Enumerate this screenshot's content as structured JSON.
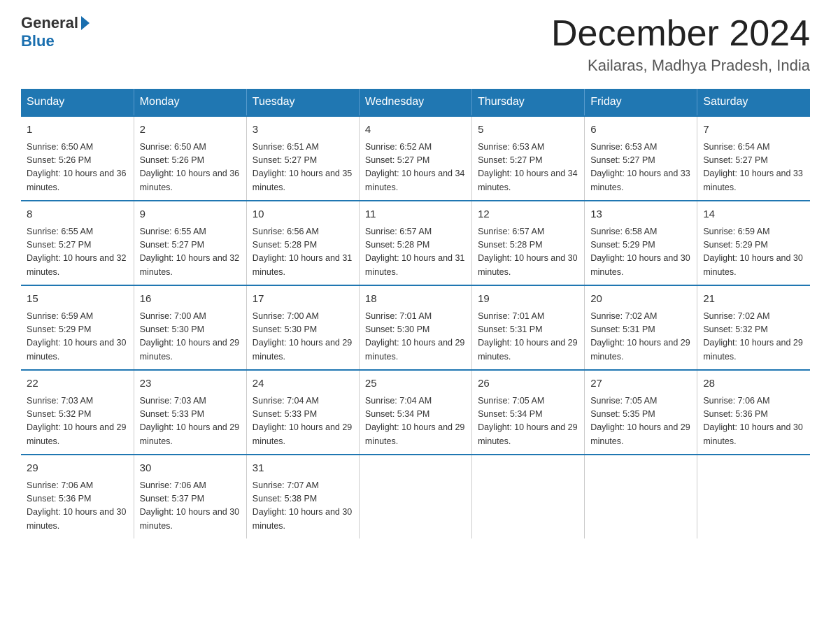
{
  "logo": {
    "text1": "General",
    "text2": "Blue"
  },
  "title": {
    "month_year": "December 2024",
    "location": "Kailaras, Madhya Pradesh, India"
  },
  "days_of_week": [
    "Sunday",
    "Monday",
    "Tuesday",
    "Wednesday",
    "Thursday",
    "Friday",
    "Saturday"
  ],
  "weeks": [
    [
      {
        "day": "1",
        "sunrise": "6:50 AM",
        "sunset": "5:26 PM",
        "daylight": "10 hours and 36 minutes."
      },
      {
        "day": "2",
        "sunrise": "6:50 AM",
        "sunset": "5:26 PM",
        "daylight": "10 hours and 36 minutes."
      },
      {
        "day": "3",
        "sunrise": "6:51 AM",
        "sunset": "5:27 PM",
        "daylight": "10 hours and 35 minutes."
      },
      {
        "day": "4",
        "sunrise": "6:52 AM",
        "sunset": "5:27 PM",
        "daylight": "10 hours and 34 minutes."
      },
      {
        "day": "5",
        "sunrise": "6:53 AM",
        "sunset": "5:27 PM",
        "daylight": "10 hours and 34 minutes."
      },
      {
        "day": "6",
        "sunrise": "6:53 AM",
        "sunset": "5:27 PM",
        "daylight": "10 hours and 33 minutes."
      },
      {
        "day": "7",
        "sunrise": "6:54 AM",
        "sunset": "5:27 PM",
        "daylight": "10 hours and 33 minutes."
      }
    ],
    [
      {
        "day": "8",
        "sunrise": "6:55 AM",
        "sunset": "5:27 PM",
        "daylight": "10 hours and 32 minutes."
      },
      {
        "day": "9",
        "sunrise": "6:55 AM",
        "sunset": "5:27 PM",
        "daylight": "10 hours and 32 minutes."
      },
      {
        "day": "10",
        "sunrise": "6:56 AM",
        "sunset": "5:28 PM",
        "daylight": "10 hours and 31 minutes."
      },
      {
        "day": "11",
        "sunrise": "6:57 AM",
        "sunset": "5:28 PM",
        "daylight": "10 hours and 31 minutes."
      },
      {
        "day": "12",
        "sunrise": "6:57 AM",
        "sunset": "5:28 PM",
        "daylight": "10 hours and 30 minutes."
      },
      {
        "day": "13",
        "sunrise": "6:58 AM",
        "sunset": "5:29 PM",
        "daylight": "10 hours and 30 minutes."
      },
      {
        "day": "14",
        "sunrise": "6:59 AM",
        "sunset": "5:29 PM",
        "daylight": "10 hours and 30 minutes."
      }
    ],
    [
      {
        "day": "15",
        "sunrise": "6:59 AM",
        "sunset": "5:29 PM",
        "daylight": "10 hours and 30 minutes."
      },
      {
        "day": "16",
        "sunrise": "7:00 AM",
        "sunset": "5:30 PM",
        "daylight": "10 hours and 29 minutes."
      },
      {
        "day": "17",
        "sunrise": "7:00 AM",
        "sunset": "5:30 PM",
        "daylight": "10 hours and 29 minutes."
      },
      {
        "day": "18",
        "sunrise": "7:01 AM",
        "sunset": "5:30 PM",
        "daylight": "10 hours and 29 minutes."
      },
      {
        "day": "19",
        "sunrise": "7:01 AM",
        "sunset": "5:31 PM",
        "daylight": "10 hours and 29 minutes."
      },
      {
        "day": "20",
        "sunrise": "7:02 AM",
        "sunset": "5:31 PM",
        "daylight": "10 hours and 29 minutes."
      },
      {
        "day": "21",
        "sunrise": "7:02 AM",
        "sunset": "5:32 PM",
        "daylight": "10 hours and 29 minutes."
      }
    ],
    [
      {
        "day": "22",
        "sunrise": "7:03 AM",
        "sunset": "5:32 PM",
        "daylight": "10 hours and 29 minutes."
      },
      {
        "day": "23",
        "sunrise": "7:03 AM",
        "sunset": "5:33 PM",
        "daylight": "10 hours and 29 minutes."
      },
      {
        "day": "24",
        "sunrise": "7:04 AM",
        "sunset": "5:33 PM",
        "daylight": "10 hours and 29 minutes."
      },
      {
        "day": "25",
        "sunrise": "7:04 AM",
        "sunset": "5:34 PM",
        "daylight": "10 hours and 29 minutes."
      },
      {
        "day": "26",
        "sunrise": "7:05 AM",
        "sunset": "5:34 PM",
        "daylight": "10 hours and 29 minutes."
      },
      {
        "day": "27",
        "sunrise": "7:05 AM",
        "sunset": "5:35 PM",
        "daylight": "10 hours and 29 minutes."
      },
      {
        "day": "28",
        "sunrise": "7:06 AM",
        "sunset": "5:36 PM",
        "daylight": "10 hours and 30 minutes."
      }
    ],
    [
      {
        "day": "29",
        "sunrise": "7:06 AM",
        "sunset": "5:36 PM",
        "daylight": "10 hours and 30 minutes."
      },
      {
        "day": "30",
        "sunrise": "7:06 AM",
        "sunset": "5:37 PM",
        "daylight": "10 hours and 30 minutes."
      },
      {
        "day": "31",
        "sunrise": "7:07 AM",
        "sunset": "5:38 PM",
        "daylight": "10 hours and 30 minutes."
      },
      null,
      null,
      null,
      null
    ]
  ]
}
